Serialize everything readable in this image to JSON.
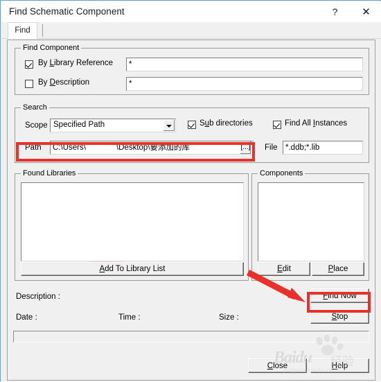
{
  "window": {
    "title": "Find Schematic Component",
    "help_icon": "question-mark-icon",
    "close_icon": "close-x-icon"
  },
  "tabs": [
    {
      "label": "Find",
      "selected": true
    }
  ],
  "find_component": {
    "group_title": "Find Component",
    "by_library_reference": {
      "label_pre": "By ",
      "label_accel": "L",
      "label_post": "ibrary Reference",
      "checked": true,
      "value": "*"
    },
    "by_description": {
      "label_pre": "By ",
      "label_accel": "D",
      "label_post": "escription",
      "checked": false,
      "value": "*"
    }
  },
  "search": {
    "group_title": "Search",
    "scope_label": "Scope",
    "scope_value": "Specified Path",
    "sub_directories": {
      "label_pre": "S",
      "label_accel": "u",
      "label_post": "b directories",
      "checked": true
    },
    "find_all_instances": {
      "label_pre": "Find All ",
      "label_accel": "I",
      "label_post": "nstances",
      "checked": true
    },
    "path_label": "Path",
    "path_value_pre": "C:\\Users\\",
    "path_value_post": "\\Desktop\\要添加的库",
    "path_redacted": true,
    "path_browse_label": "[...]",
    "file_label": "File",
    "file_value": "*.ddb;*.lib"
  },
  "found_libraries": {
    "group_title": "Found Libraries",
    "items": [],
    "add_button_pre": "A",
    "add_button_accel": "A",
    "add_button_label": "dd To Library List"
  },
  "components": {
    "group_title": "Components",
    "items": [],
    "edit_button_pre": "E",
    "edit_button_post": "dit",
    "place_button_pre": "P",
    "place_button_post": "lace"
  },
  "info": {
    "description_label": "Description :",
    "description_value": "",
    "date_label": "Date :",
    "date_value": "",
    "time_label": "Time :",
    "time_value": "",
    "size_label": "Size :",
    "size_value": "",
    "status_text": ""
  },
  "actions": {
    "find_now_pre": "F",
    "find_now_post": "ind Now",
    "stop_pre": "S",
    "stop_post": "top",
    "close_pre": "C",
    "close_post": "lose",
    "help_pre": "H",
    "help_post": "elp"
  },
  "annotations": {
    "highlight_color": "#e8312a",
    "arrow_color": "#e8312a",
    "highlighted_path_field": true,
    "highlighted_find_now": true,
    "arrow_from_edit_to_find_now": true
  },
  "watermark": {
    "brand": "Baidu",
    "suffix": "经验",
    "subtext": "jingyan.baidu.com",
    "logo": "paw-print-icon"
  }
}
